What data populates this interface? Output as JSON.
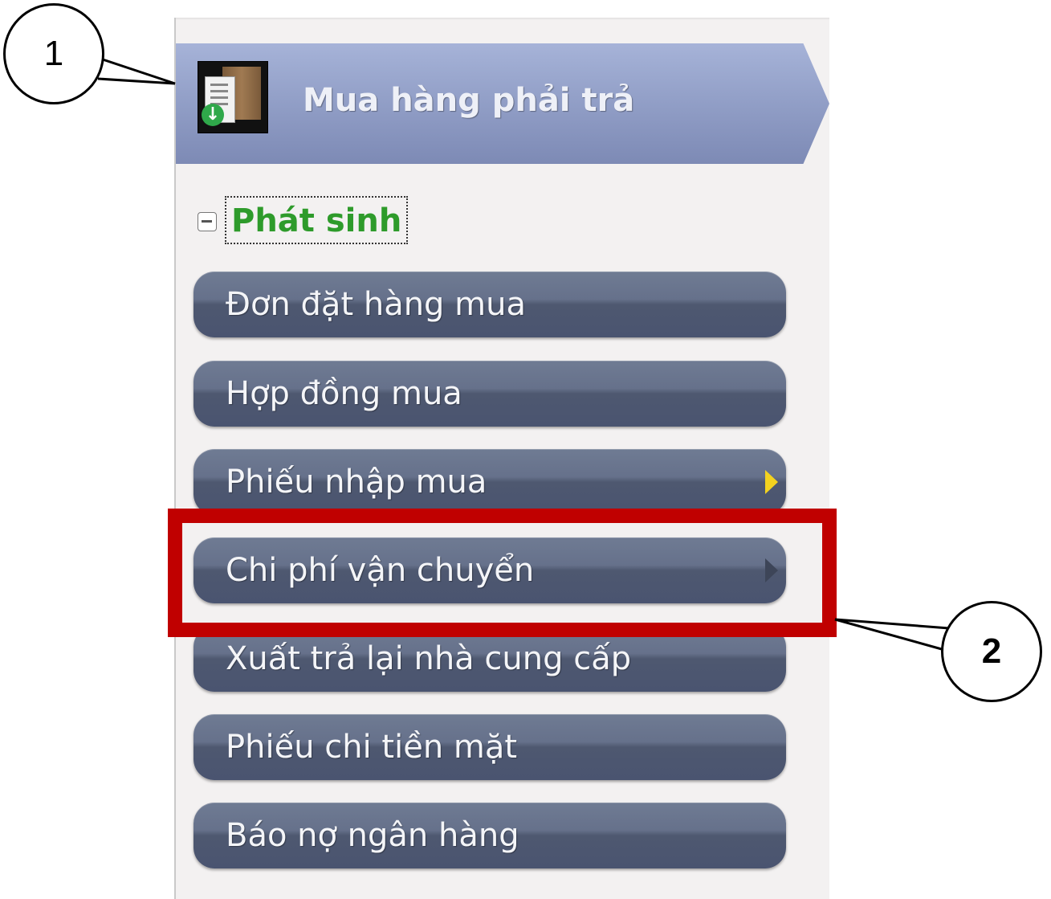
{
  "module": {
    "title": "Mua hàng phải trả",
    "icon": "purchase-documents-icon"
  },
  "group": {
    "label": "Phát sinh",
    "toggle": "−"
  },
  "menu_items": [
    {
      "label": "Đơn đặt hàng mua"
    },
    {
      "label": "Hợp đồng mua"
    },
    {
      "label": "Phiếu nhập mua",
      "submenu": true
    },
    {
      "label": "Chi phí vận chuyển",
      "submenu": true,
      "highlighted": true
    },
    {
      "label": "Xuất trả lại nhà cung cấp"
    },
    {
      "label": "Phiếu chi tiền mặt"
    },
    {
      "label": "Báo nợ ngân hàng"
    }
  ],
  "callouts": {
    "first": "1",
    "second": "2"
  },
  "colors": {
    "highlight": "#c00000",
    "group_label": "#2e9b2b",
    "submenu_arrow": "#f3d21f"
  }
}
